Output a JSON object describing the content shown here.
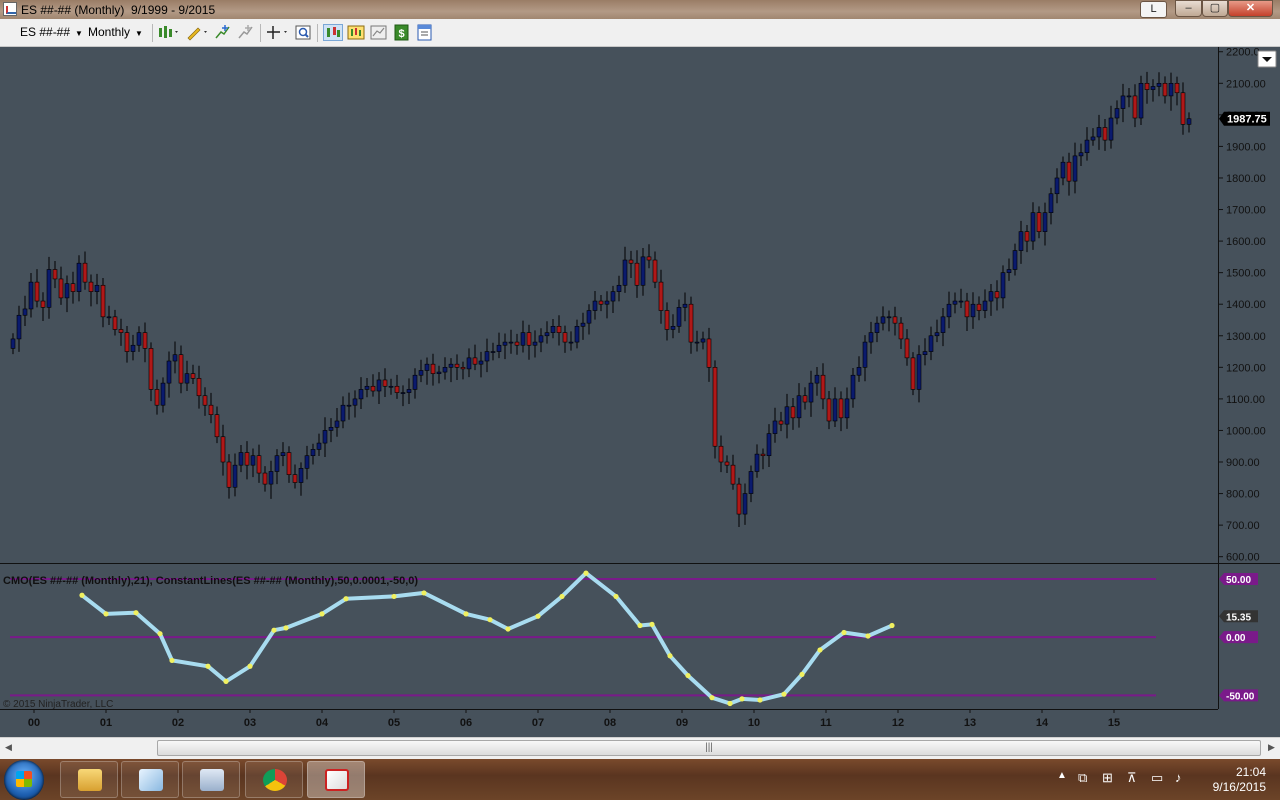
{
  "window": {
    "title": "ES ##-## (Monthly)  9/1999 - 9/2015",
    "l_button": "L",
    "min_symbol": "–",
    "max_symbol": "▢",
    "close_symbol": "✕"
  },
  "toolbar": {
    "instrument": "ES ##-##",
    "interval": "Monthly",
    "icons": [
      "bar-type-icon",
      "drawing-pencil-icon",
      "add-indicator-icon",
      "add-strategy-icon",
      "crosshair-icon",
      "zoom-icon",
      "chart-trader-icon",
      "data-box-icon",
      "chart-style-icon",
      "dollar-icon",
      "properties-icon"
    ]
  },
  "price_panel": {
    "y_ticks": [
      "2200.0",
      "2100.00",
      "2000.00",
      "1900.00",
      "1800.00",
      "1700.00",
      "1600.00",
      "1500.00",
      "1400.00",
      "1300.00",
      "1200.00",
      "1100.00",
      "1000.00",
      "900.00",
      "800.00",
      "700.00",
      "600.00"
    ],
    "last_price": "1987.75"
  },
  "indicator_panel": {
    "label": "CMO(ES ##-## (Monthly),21), ConstantLines(ES ##-## (Monthly),50,0.0001,-50,0)",
    "line_labels": [
      "50.00",
      "0.00",
      "-50.00"
    ],
    "current_value": "15.35",
    "copyright": "© 2015 NinjaTrader, LLC"
  },
  "x_ticks": [
    "00",
    "01",
    "02",
    "03",
    "04",
    "05",
    "06",
    "07",
    "08",
    "09",
    "10",
    "11",
    "12",
    "13",
    "14",
    "15"
  ],
  "colors": {
    "background": "#4a5560",
    "up_candle": "#0a1a6e",
    "down_candle": "#b01818",
    "cmo_line": "#a8dcf0",
    "cmo_dots": "#f0f060",
    "constant_lines": "#7a1a8a"
  },
  "chart_data": {
    "type": "candlestick",
    "x_start": "1999-09",
    "interval": "monthly",
    "ylim": [
      580,
      2215
    ],
    "price_series": {
      "name": "ES ##-##",
      "closes": [
        1290,
        1365,
        1385,
        1470,
        1410,
        1390,
        1510,
        1480,
        1420,
        1465,
        1440,
        1530,
        1470,
        1440,
        1460,
        1360,
        1360,
        1320,
        1310,
        1250,
        1270,
        1310,
        1260,
        1130,
        1080,
        1150,
        1220,
        1240,
        1150,
        1180,
        1165,
        1110,
        1080,
        1050,
        980,
        900,
        820,
        890,
        930,
        890,
        920,
        865,
        830,
        870,
        920,
        930,
        860,
        835,
        880,
        920,
        940,
        960,
        1000,
        1010,
        1030,
        1080,
        1080,
        1100,
        1130,
        1140,
        1125,
        1160,
        1140,
        1140,
        1120,
        1120,
        1130,
        1175,
        1190,
        1210,
        1180,
        1185,
        1200,
        1210,
        1200,
        1195,
        1230,
        1210,
        1220,
        1250,
        1250,
        1270,
        1280,
        1280,
        1270,
        1310,
        1270,
        1280,
        1300,
        1310,
        1330,
        1310,
        1280,
        1280,
        1330,
        1340,
        1380,
        1410,
        1400,
        1410,
        1440,
        1460,
        1540,
        1530,
        1460,
        1550,
        1540,
        1470,
        1380,
        1320,
        1330,
        1390,
        1400,
        1280,
        1280,
        1290,
        1200,
        950,
        900,
        890,
        830,
        735,
        800,
        870,
        925,
        920,
        990,
        1030,
        1020,
        1075,
        1040,
        1110,
        1090,
        1150,
        1175,
        1100,
        1030,
        1100,
        1040,
        1100,
        1175,
        1200,
        1280,
        1310,
        1340,
        1360,
        1360,
        1340,
        1290,
        1230,
        1130,
        1240,
        1250,
        1300,
        1310,
        1360,
        1400,
        1410,
        1410,
        1360,
        1400,
        1380,
        1410,
        1440,
        1420,
        1500,
        1510,
        1570,
        1630,
        1600,
        1690,
        1630,
        1690,
        1750,
        1800,
        1850,
        1790,
        1870,
        1880,
        1920,
        1930,
        1960,
        1920,
        1990,
        2020,
        2060,
        2060,
        1990,
        2100,
        2080,
        2090,
        2100,
        2060,
        2100,
        2070,
        1970,
        1987.75
      ]
    },
    "cmo_series": {
      "name": "CMO(ES ##-## (Monthly),21)",
      "ylim": [
        -60,
        62
      ],
      "points": [
        [
          "2000-09",
          36
        ],
        [
          "2001-01",
          20
        ],
        [
          "2001-06",
          21
        ],
        [
          "2001-10",
          3
        ],
        [
          "2001-12",
          -20
        ],
        [
          "2002-06",
          -25
        ],
        [
          "2002-09",
          -38
        ],
        [
          "2003-01",
          -25
        ],
        [
          "2003-05",
          6
        ],
        [
          "2003-07",
          8
        ],
        [
          "2004-01",
          20
        ],
        [
          "2004-05",
          33
        ],
        [
          "2005-01",
          35
        ],
        [
          "2005-06",
          38
        ],
        [
          "2006-01",
          20
        ],
        [
          "2006-05",
          15
        ],
        [
          "2006-08",
          7
        ],
        [
          "2007-01",
          18
        ],
        [
          "2007-05",
          35
        ],
        [
          "2007-09",
          55
        ],
        [
          "2008-02",
          35
        ],
        [
          "2008-06",
          10
        ],
        [
          "2008-08",
          11
        ],
        [
          "2008-11",
          -16
        ],
        [
          "2009-02",
          -33
        ],
        [
          "2009-06",
          -52
        ],
        [
          "2009-09",
          -57
        ],
        [
          "2009-11",
          -53
        ],
        [
          "2010-02",
          -54
        ],
        [
          "2010-06",
          -49
        ],
        [
          "2010-09",
          -32
        ],
        [
          "2010-12",
          -11
        ],
        [
          "2011-04",
          4
        ],
        [
          "2011-08",
          1
        ],
        [
          "2011-12",
          10
        ]
      ]
    },
    "constant_lines": [
      50,
      0,
      -50
    ],
    "x_labels": [
      "00",
      "01",
      "02",
      "03",
      "04",
      "05",
      "06",
      "07",
      "08",
      "09",
      "10",
      "11",
      "12",
      "13",
      "14",
      "15"
    ],
    "y_labels": [
      "600.00",
      "700.00",
      "800.00",
      "900.00",
      "1000.00",
      "1100.00",
      "1200.00",
      "1300.00",
      "1400.00",
      "1500.00",
      "1600.00",
      "1700.00",
      "1800.00",
      "1900.00",
      "2000.00",
      "2100.00",
      "2200.0"
    ]
  }
}
